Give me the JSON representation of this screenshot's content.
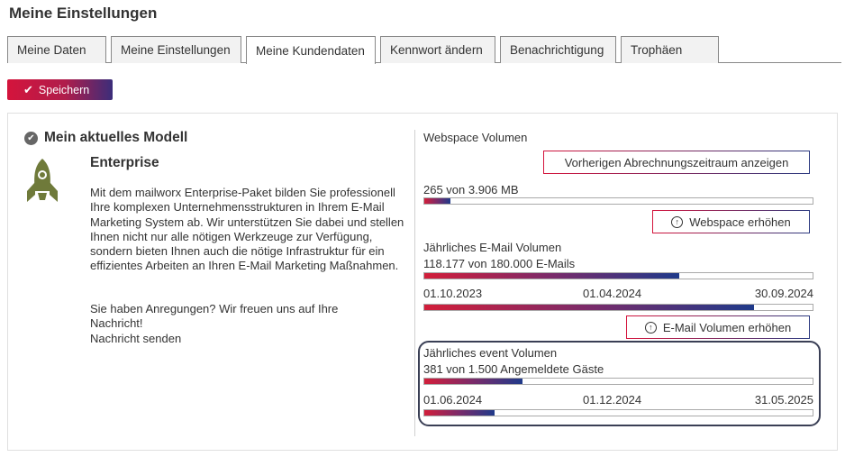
{
  "page_title": "Meine Einstellungen",
  "tabs": [
    {
      "label": "Meine Daten"
    },
    {
      "label": "Meine Einstellungen"
    },
    {
      "label": "Meine Kundendaten",
      "active": true
    },
    {
      "label": "Kennwort ändern"
    },
    {
      "label": "Benachrichtigung"
    },
    {
      "label": "Trophäen"
    }
  ],
  "save_button": {
    "label": "Speichern",
    "icon": "check-icon"
  },
  "model": {
    "heading": "Mein aktuelles Modell",
    "icon": "rocket-icon",
    "plan": "Enterprise",
    "description": "Mit dem mailworx Enterprise-Paket bilden Sie professionell Ihre komplexen Unternehmensstrukturen in Ihrem E-Mail Marketing System ab. Wir unterstützen Sie dabei und stellen Ihnen nicht nur alle nötigen Werkzeuge zur Verfügung, sondern bieten Ihnen auch die nötige Infrastruktur für ein effizientes Arbeiten an Ihren E-Mail Marketing Maßnahmen.",
    "feedback_line1": "Sie haben Anregungen? Wir freuen uns auf Ihre Nachricht!",
    "feedback_line2": "Nachricht senden"
  },
  "webspace": {
    "title": "Webspace Volumen",
    "prev_period_button": "Vorherigen Abrechnungszeitraum anzeigen",
    "usage": "265 von 3.906 MB",
    "usage_fraction": 0.068,
    "increase_button": "Webspace erhöhen"
  },
  "email_volume": {
    "title": "Jährliches E-Mail Volumen",
    "usage": "118.177 von 180.000 E-Mails",
    "usage_fraction": 0.656,
    "start_date": "01.10.2023",
    "mid_date": "01.04.2024",
    "end_date": "30.09.2024",
    "time_fraction": 0.85,
    "increase_button": "E-Mail Volumen erhöhen"
  },
  "event_volume": {
    "title": "Jährliches event Volumen",
    "usage": "381 von 1.500 Angemeldete Gäste",
    "usage_fraction": 0.254,
    "start_date": "01.06.2024",
    "mid_date": "01.12.2024",
    "end_date": "31.05.2025",
    "time_fraction": 0.18
  },
  "colors": {
    "accent_red": "#d4143c",
    "accent_blue": "#2b3a80",
    "rocket": "#6f7a3a"
  }
}
